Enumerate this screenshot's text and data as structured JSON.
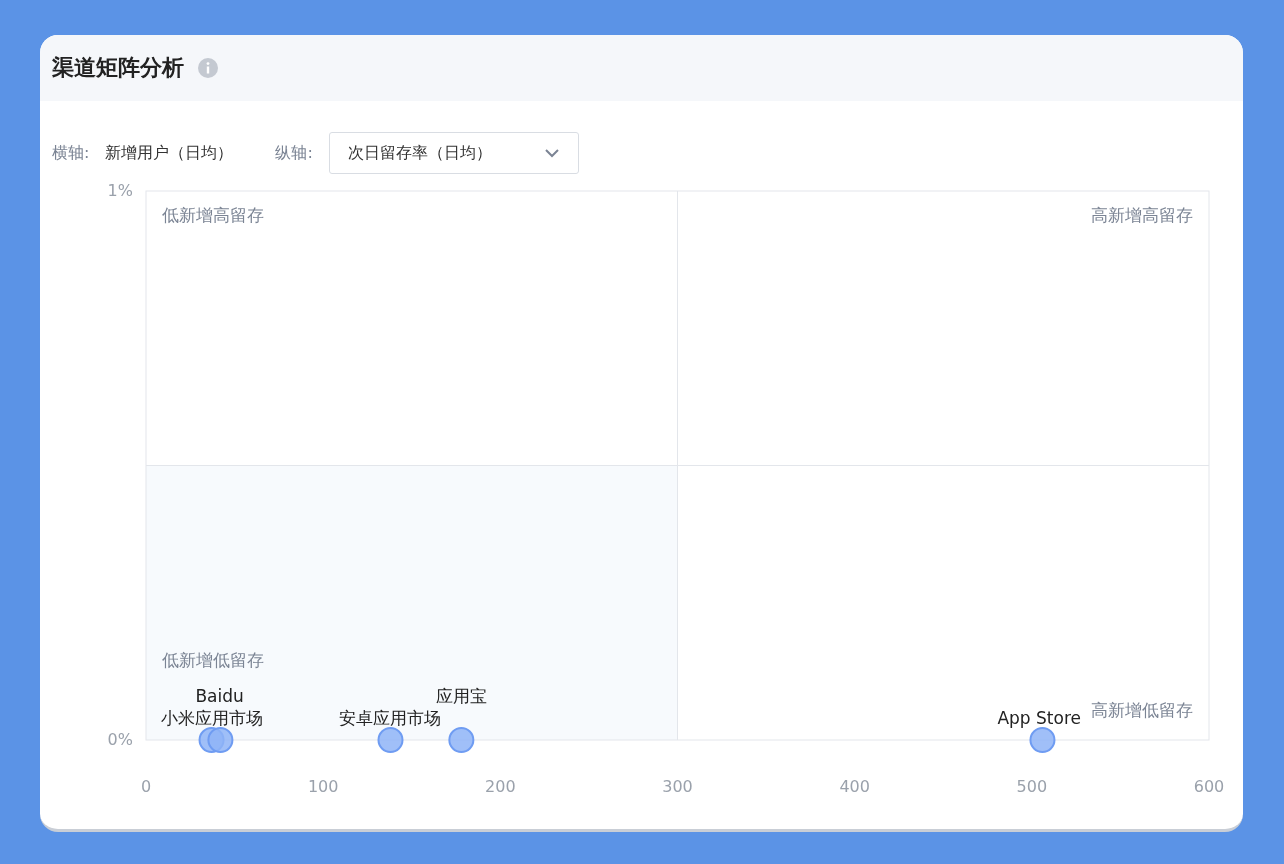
{
  "card": {
    "title": "渠道矩阵分析"
  },
  "controls": {
    "x_axis_label": "横轴:",
    "x_axis_value": "新增用户（日均）",
    "y_axis_label": "纵轴:",
    "y_axis_select": "次日留存率（日均）"
  },
  "quadrants": [
    "低新增高留存",
    "高新增高留存",
    "低新增低留存",
    "高新增低留存"
  ],
  "chart_data": {
    "type": "scatter",
    "xlim": [
      0,
      600
    ],
    "ylim": [
      0,
      1
    ],
    "xticks": [
      0,
      100,
      200,
      300,
      400,
      500,
      600
    ],
    "yticks": [
      {
        "value": 0,
        "label": "0%"
      },
      {
        "value": 1,
        "label": "1%"
      }
    ],
    "series": [
      {
        "name": "小米应用市场",
        "color": "#8fb4f7",
        "x": [
          37
        ],
        "values": [
          0
        ]
      },
      {
        "name": "Baidu",
        "color": "#8fb4f7",
        "x": [
          42
        ],
        "values": [
          0
        ]
      },
      {
        "name": "安卓应用市场",
        "color": "#8fb4f7",
        "x": [
          138
        ],
        "values": [
          0
        ]
      },
      {
        "name": "应用宝",
        "color": "#8fb4f7",
        "x": [
          178
        ],
        "values": [
          0
        ]
      },
      {
        "name": "App Store",
        "color": "#8fb4f7",
        "x": [
          506
        ],
        "values": [
          0
        ]
      }
    ]
  }
}
